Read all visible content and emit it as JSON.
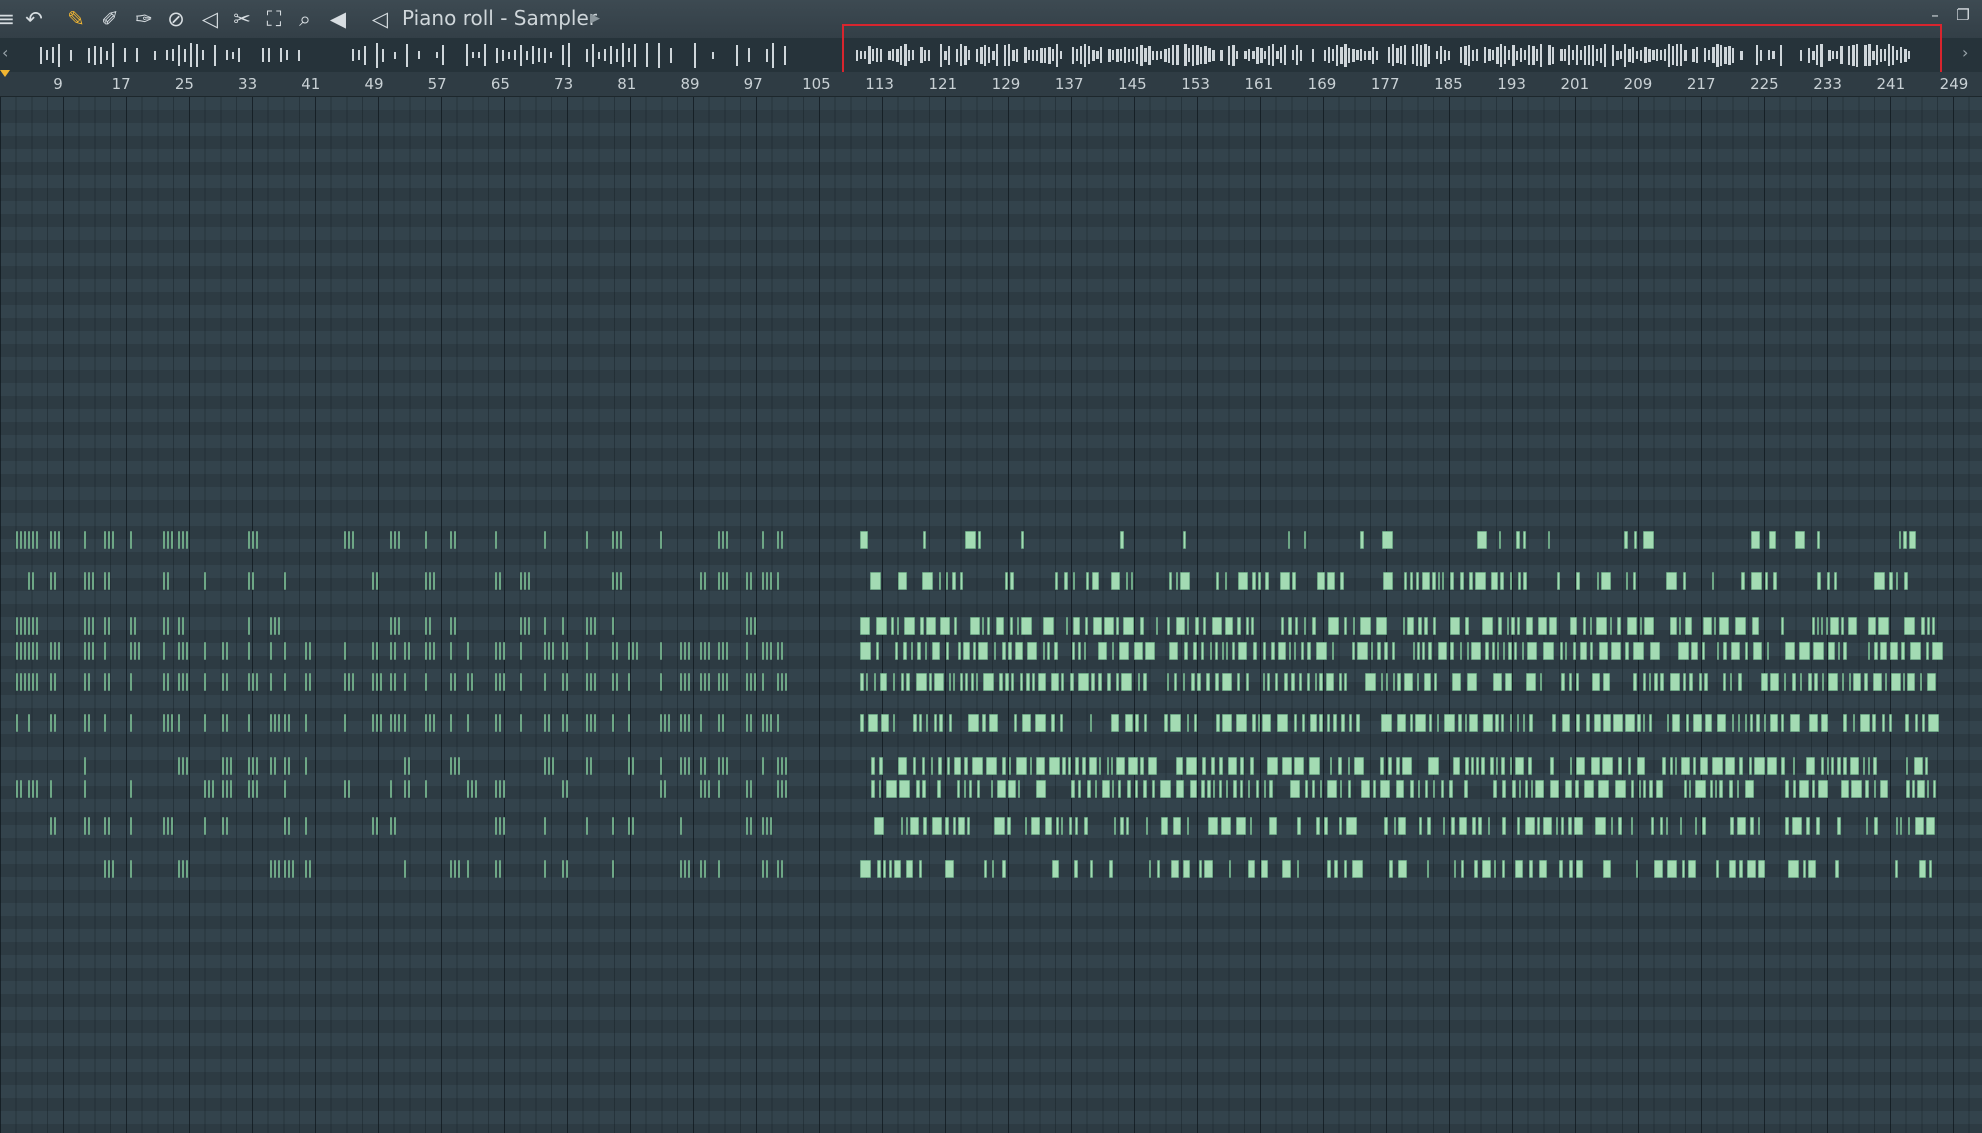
{
  "window": {
    "title": "Piano roll - Sampler",
    "minimize_glyph": "–",
    "restore_glyph": "❐"
  },
  "toolbar": {
    "icons": [
      "menu-icon",
      "undo-icon",
      "draw-pencil-icon",
      "paint-brush-icon",
      "delete-icon",
      "mute-icon",
      "slip-mute-icon",
      "slice-icon",
      "select-icon",
      "zoom-icon",
      "playback-icon",
      "speaker-icon"
    ]
  },
  "overview": {
    "left_arrow": "‹",
    "right_arrow": "›",
    "highlight_color": "#d8252e"
  },
  "timeline": {
    "bar_numbers": [
      "9",
      "17",
      "25",
      "33",
      "41",
      "49",
      "57",
      "65",
      "73",
      "81",
      "89",
      "97",
      "105",
      "113",
      "121",
      "129",
      "137",
      "145",
      "153",
      "161",
      "169",
      "177",
      "185",
      "193",
      "201",
      "209",
      "217",
      "225",
      "233",
      "241",
      "249"
    ],
    "first_bar": 1,
    "last_bar": 249
  },
  "colors": {
    "note_fill": "#a3dbb3",
    "grid_background": "#33434c",
    "accent": "#f2b632"
  }
}
